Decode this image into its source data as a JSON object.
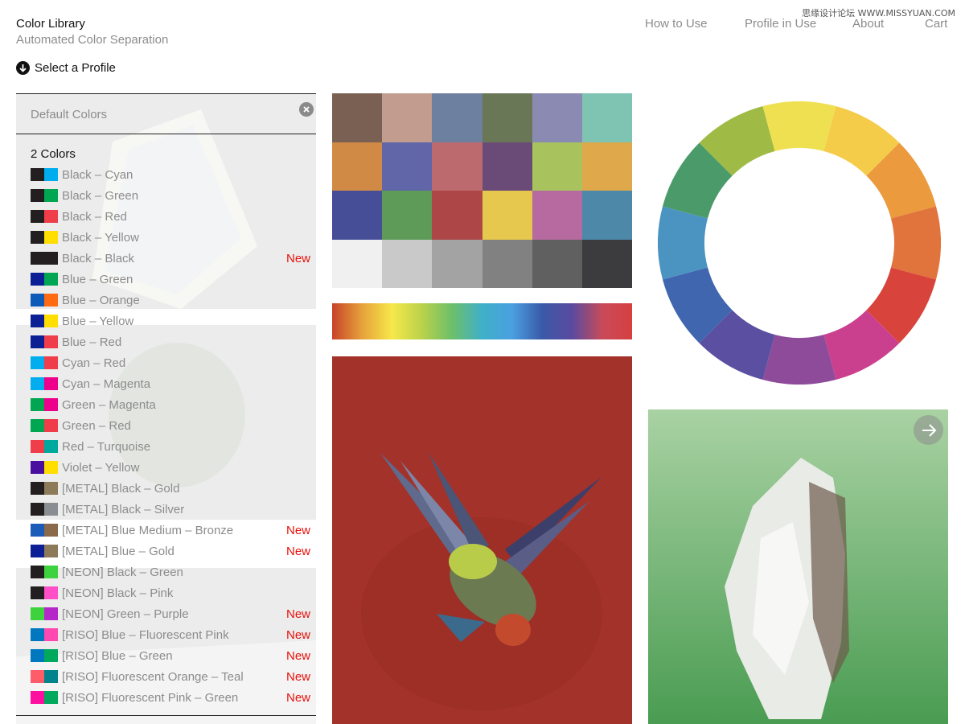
{
  "brand": {
    "title": "Color Library",
    "subtitle": "Automated Color Separation"
  },
  "nav": [
    {
      "label": "How to Use"
    },
    {
      "label": "Profile in Use"
    },
    {
      "label": "About"
    },
    {
      "label": "Cart"
    }
  ],
  "watermark": "思缘设计论坛 WWW.MISSYUAN.COM",
  "select_profile": {
    "label": "Select a Profile",
    "icon": "arrow-down-circle-icon"
  },
  "panel": {
    "header": "Default Colors",
    "close_icon": "close-icon",
    "group_label": "2 Colors",
    "new_label": "New",
    "items": [
      {
        "label": "Black – Cyan",
        "colors": [
          "#231f20",
          "#00aeef"
        ],
        "is_new": false
      },
      {
        "label": "Black – Green",
        "colors": [
          "#231f20",
          "#00a651"
        ],
        "is_new": false
      },
      {
        "label": "Black – Red",
        "colors": [
          "#231f20",
          "#ef3e4a"
        ],
        "is_new": false
      },
      {
        "label": "Black – Yellow",
        "colors": [
          "#231f20",
          "#ffde00"
        ],
        "is_new": false
      },
      {
        "label": "Black – Black",
        "colors": [
          "#231f20",
          "#231f20"
        ],
        "is_new": true
      },
      {
        "label": "Blue – Green",
        "colors": [
          "#0d1f94",
          "#00a651"
        ],
        "is_new": false
      },
      {
        "label": "Blue – Orange",
        "colors": [
          "#0d5ab8",
          "#ff6a13"
        ],
        "is_new": false
      },
      {
        "label": "Blue – Yellow",
        "colors": [
          "#0d1f94",
          "#ffde00"
        ],
        "is_new": false
      },
      {
        "label": "Blue – Red",
        "colors": [
          "#0d1f94",
          "#ef3e4a"
        ],
        "is_new": false
      },
      {
        "label": "Cyan – Red",
        "colors": [
          "#00aeef",
          "#ef3e4a"
        ],
        "is_new": false
      },
      {
        "label": "Cyan – Magenta",
        "colors": [
          "#00aeef",
          "#ec008c"
        ],
        "is_new": false
      },
      {
        "label": "Green – Magenta",
        "colors": [
          "#00a651",
          "#ec008c"
        ],
        "is_new": false
      },
      {
        "label": "Green – Red",
        "colors": [
          "#00a651",
          "#ef3e4a"
        ],
        "is_new": false
      },
      {
        "label": "Red – Turquoise",
        "colors": [
          "#ef3e4a",
          "#00a99d"
        ],
        "is_new": false
      },
      {
        "label": "Violet – Yellow",
        "colors": [
          "#4b0fa0",
          "#ffde00"
        ],
        "is_new": false
      },
      {
        "label": "[METAL] Black – Gold",
        "colors": [
          "#231f20",
          "#8c7a58"
        ],
        "is_new": false
      },
      {
        "label": "[METAL] Black – Silver",
        "colors": [
          "#231f20",
          "#8a8d91"
        ],
        "is_new": false
      },
      {
        "label": "[METAL] Blue Medium – Bronze",
        "colors": [
          "#1a5cb8",
          "#8a6a4a"
        ],
        "is_new": true
      },
      {
        "label": "[METAL] Blue – Gold",
        "colors": [
          "#0d1f94",
          "#8c7a58"
        ],
        "is_new": true
      },
      {
        "label": "[NEON] Black – Green",
        "colors": [
          "#231f20",
          "#3ed33e"
        ],
        "is_new": false
      },
      {
        "label": "[NEON] Black – Pink",
        "colors": [
          "#231f20",
          "#ff4fc8"
        ],
        "is_new": false
      },
      {
        "label": "[NEON] Green – Purple",
        "colors": [
          "#3ed33e",
          "#b427c8"
        ],
        "is_new": true
      },
      {
        "label": "[RISO] Blue – Fluorescent Pink",
        "colors": [
          "#0078bf",
          "#ff48b0"
        ],
        "is_new": true
      },
      {
        "label": "[RISO] Blue – Green",
        "colors": [
          "#0078bf",
          "#00a95c"
        ],
        "is_new": true
      },
      {
        "label": "[RISO] Fluorescent Orange – Teal",
        "colors": [
          "#ff5c6a",
          "#00838a"
        ],
        "is_new": true
      },
      {
        "label": "[RISO] Fluorescent Pink – Green",
        "colors": [
          "#ff0fa0",
          "#00a95c"
        ],
        "is_new": true
      }
    ]
  },
  "color_grid": [
    "#7a6052",
    "#c19c8f",
    "#6d80a0",
    "#6a7756",
    "#8a8ab2",
    "#7fc3b2",
    "#d08a45",
    "#6066a8",
    "#bd6a6e",
    "#6a4b78",
    "#a8c25e",
    "#dea84b",
    "#474e98",
    "#5e9a58",
    "#ad4646",
    "#e6c84e",
    "#b66aa0",
    "#4d88a8",
    "#f0f0f0",
    "#c9c9c9",
    "#a3a3a3",
    "#818181",
    "#606060",
    "#3c3c3e"
  ],
  "gradient_stops": [
    "#c8432a",
    "#e6a23a",
    "#f6e84a",
    "#b9d24a",
    "#6cbf6a",
    "#3fb0c8",
    "#4aa0e0",
    "#3a5aa8",
    "#5a4aa0",
    "#c84a5a",
    "#d64040"
  ],
  "color_wheel": [
    "#efe052",
    "#f5cb4a",
    "#eb9a3e",
    "#e1743c",
    "#d8443b",
    "#cb3f8f",
    "#8e4b9a",
    "#5a4fa0",
    "#3f66ae",
    "#4b94c2",
    "#4b9a6a",
    "#9fbb45"
  ],
  "images": {
    "bird_photo": "bird-photo",
    "mineral_photo": "mineral-photo",
    "next_icon": "arrow-right-icon"
  }
}
